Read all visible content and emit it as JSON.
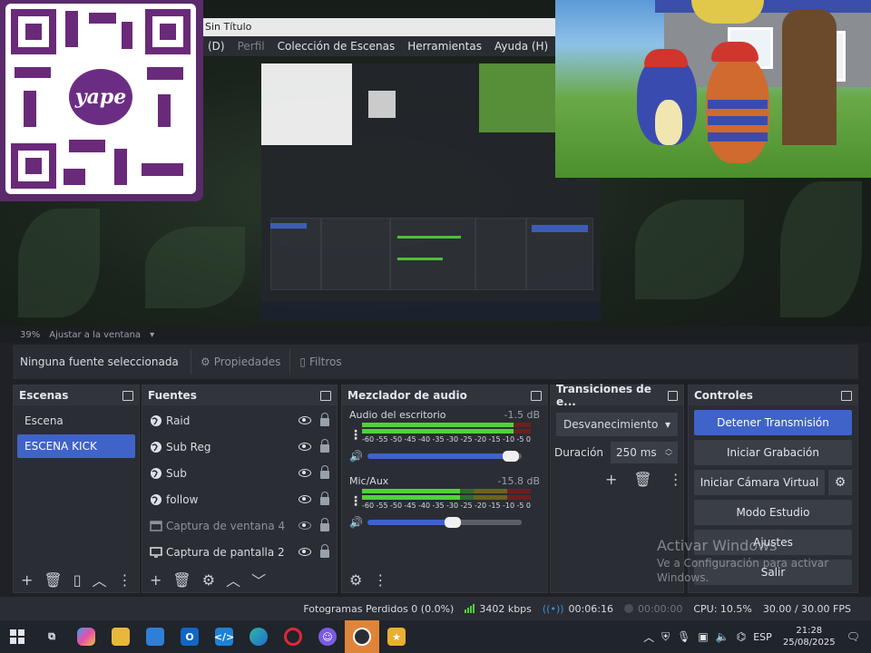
{
  "window": {
    "title": "Sin Título",
    "menu": [
      {
        "label": "(D)",
        "dim": false
      },
      {
        "label": "Perfil",
        "dim": true
      },
      {
        "label": "Colección de Escenas",
        "dim": false
      },
      {
        "label": "Herramientas",
        "dim": false
      },
      {
        "label": "Ayuda (H)",
        "dim": false
      }
    ]
  },
  "qr": {
    "brand": "yape"
  },
  "preview": {
    "zoom": "39%",
    "fit_label": "Ajustar a la ventana"
  },
  "properties_bar": {
    "no_source": "Ninguna fuente seleccionada",
    "properties": "Propiedades",
    "filters": "Filtros"
  },
  "scenes": {
    "title": "Escenas",
    "items": [
      {
        "label": "Escena",
        "active": false
      },
      {
        "label": "ESCENA KICK",
        "active": true
      }
    ]
  },
  "sources": {
    "title": "Fuentes",
    "items": [
      {
        "label": "Raid",
        "type": "globe-icon",
        "dim": false
      },
      {
        "label": "Sub Reg",
        "type": "globe-icon",
        "dim": false
      },
      {
        "label": "Sub",
        "type": "globe-icon",
        "dim": false
      },
      {
        "label": "follow",
        "type": "globe-icon",
        "dim": false
      },
      {
        "label": "Captura de ventana 4",
        "type": "window-capture-icon",
        "dim": true
      },
      {
        "label": "Captura de pantalla 2",
        "type": "monitor-icon",
        "dim": false
      }
    ]
  },
  "mixer": {
    "title": "Mezclador de audio",
    "ticks": [
      "-60",
      "-55",
      "-50",
      "-45",
      "-40",
      "-35",
      "-30",
      "-25",
      "-20",
      "-15",
      "-10",
      "-5",
      "0"
    ],
    "channels": [
      {
        "name": "Audio del escritorio",
        "db": "-1.5 dB",
        "level": 0.9,
        "fader": 0.93
      },
      {
        "name": "Mic/Aux",
        "db": "-15.8 dB",
        "level": 0.58,
        "fader": 0.55
      }
    ]
  },
  "transitions": {
    "title": "Transiciones de e...",
    "selected": "Desvanecimiento",
    "duration_label": "Duración",
    "duration_value": "250 ms"
  },
  "controls": {
    "title": "Controles",
    "stop_stream": "Detener Transmisión",
    "start_recording": "Iniciar Grabación",
    "start_virtual_cam": "Iniciar Cámara Virtual",
    "studio_mode": "Modo Estudio",
    "settings": "Ajustes",
    "exit": "Salir"
  },
  "watermark": {
    "title": "Activar Windows",
    "line1": "Ve a Configuración para activar",
    "line2": "Windows."
  },
  "status": {
    "dropped_frames": "Fotogramas Perdidos 0 (0.0%)",
    "bitrate": "3402 kbps",
    "stream_time": "00:06:16",
    "rec_time": "00:00:00",
    "cpu": "CPU: 10.5%",
    "fps": "30.00 / 30.00 FPS"
  },
  "taskbar": {
    "language": "ESP",
    "time": "21:28",
    "date": "25/08/2025"
  },
  "colors": {
    "accent": "#3f63c8",
    "meter_green": "#53d13a",
    "obs_active": "#e0843a"
  }
}
